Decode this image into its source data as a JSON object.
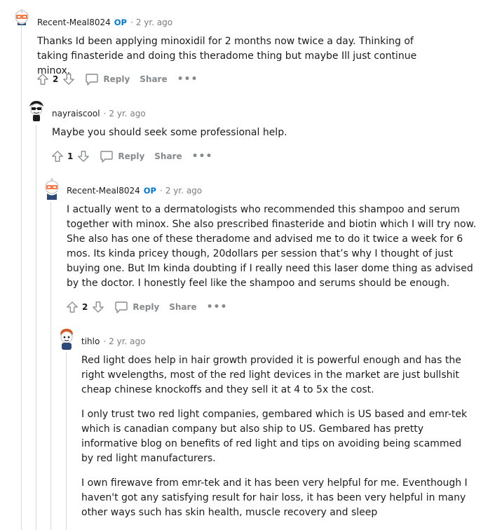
{
  "comments": [
    {
      "author": "Recent-Meal8024",
      "op_badge": "OP",
      "separator": "·",
      "time": "2 yr. ago",
      "paragraphs": [
        "Thanks Id been applying minoxidil for 2 months now twice a day. Thinking of taking finasteride and doing this theradome thing but maybe Ill just continue minox."
      ],
      "score": "2",
      "reply_label": "Reply",
      "share_label": "Share",
      "more_label": "•••"
    },
    {
      "author": "nayraiscool",
      "separator": "·",
      "time": "2 yr. ago",
      "paragraphs": [
        "Maybe you should seek some professional help."
      ],
      "score": "1",
      "reply_label": "Reply",
      "share_label": "Share",
      "more_label": "•••"
    },
    {
      "author": "Recent-Meal8024",
      "op_badge": "OP",
      "separator": "·",
      "time": "2 yr. ago",
      "paragraphs": [
        "I actually went to a dermatologists who recommended this shampoo and serum together with minox. She also prescribed finasteride and biotin which I will try now. She also has one of these theradome and advised me to do it twice a week for 6 mos. Its kinda pricey though, 20dollars per session that’s why I thought of just buying one. But Im kinda doubting if I really need this laser dome thing as advised by the doctor. I honestly feel like the shampoo and serums should be enough."
      ],
      "score": "2",
      "reply_label": "Reply",
      "share_label": "Share",
      "more_label": "•••"
    },
    {
      "author": "tihlo",
      "separator": "·",
      "time": "2 yr. ago",
      "paragraphs": [
        "Red light does help in hair growth provided it is powerful enough and has the right wvelengths, most of the red light devices in the market are just bullshit cheap chinese knockoffs and they sell it at 4 to 5x the cost.",
        "I only trust two red light companies, gembared which is US based and emr-tek which is canadian company but also ship to US. Gembared has pretty informative blog on benefits of red light and tips on avoiding being scammed by red light manufacturers.",
        "I own firewave from emr-tek and it has been very helpful for me. Eventhough I haven't got any satisfying result for hair loss, it has been very helpful in many other ways such has skin health, muscle recovery and sleep"
      ]
    }
  ],
  "colors": {
    "op_badge": "#0079d3",
    "meta_text": "#7c7c7c",
    "action_text": "#878a8c",
    "thread_line": "#d9dbdd"
  },
  "icons": [
    "snoo-avatar-icon",
    "upvote-icon",
    "downvote-icon",
    "comment-bubble-icon",
    "more-options-icon"
  ]
}
